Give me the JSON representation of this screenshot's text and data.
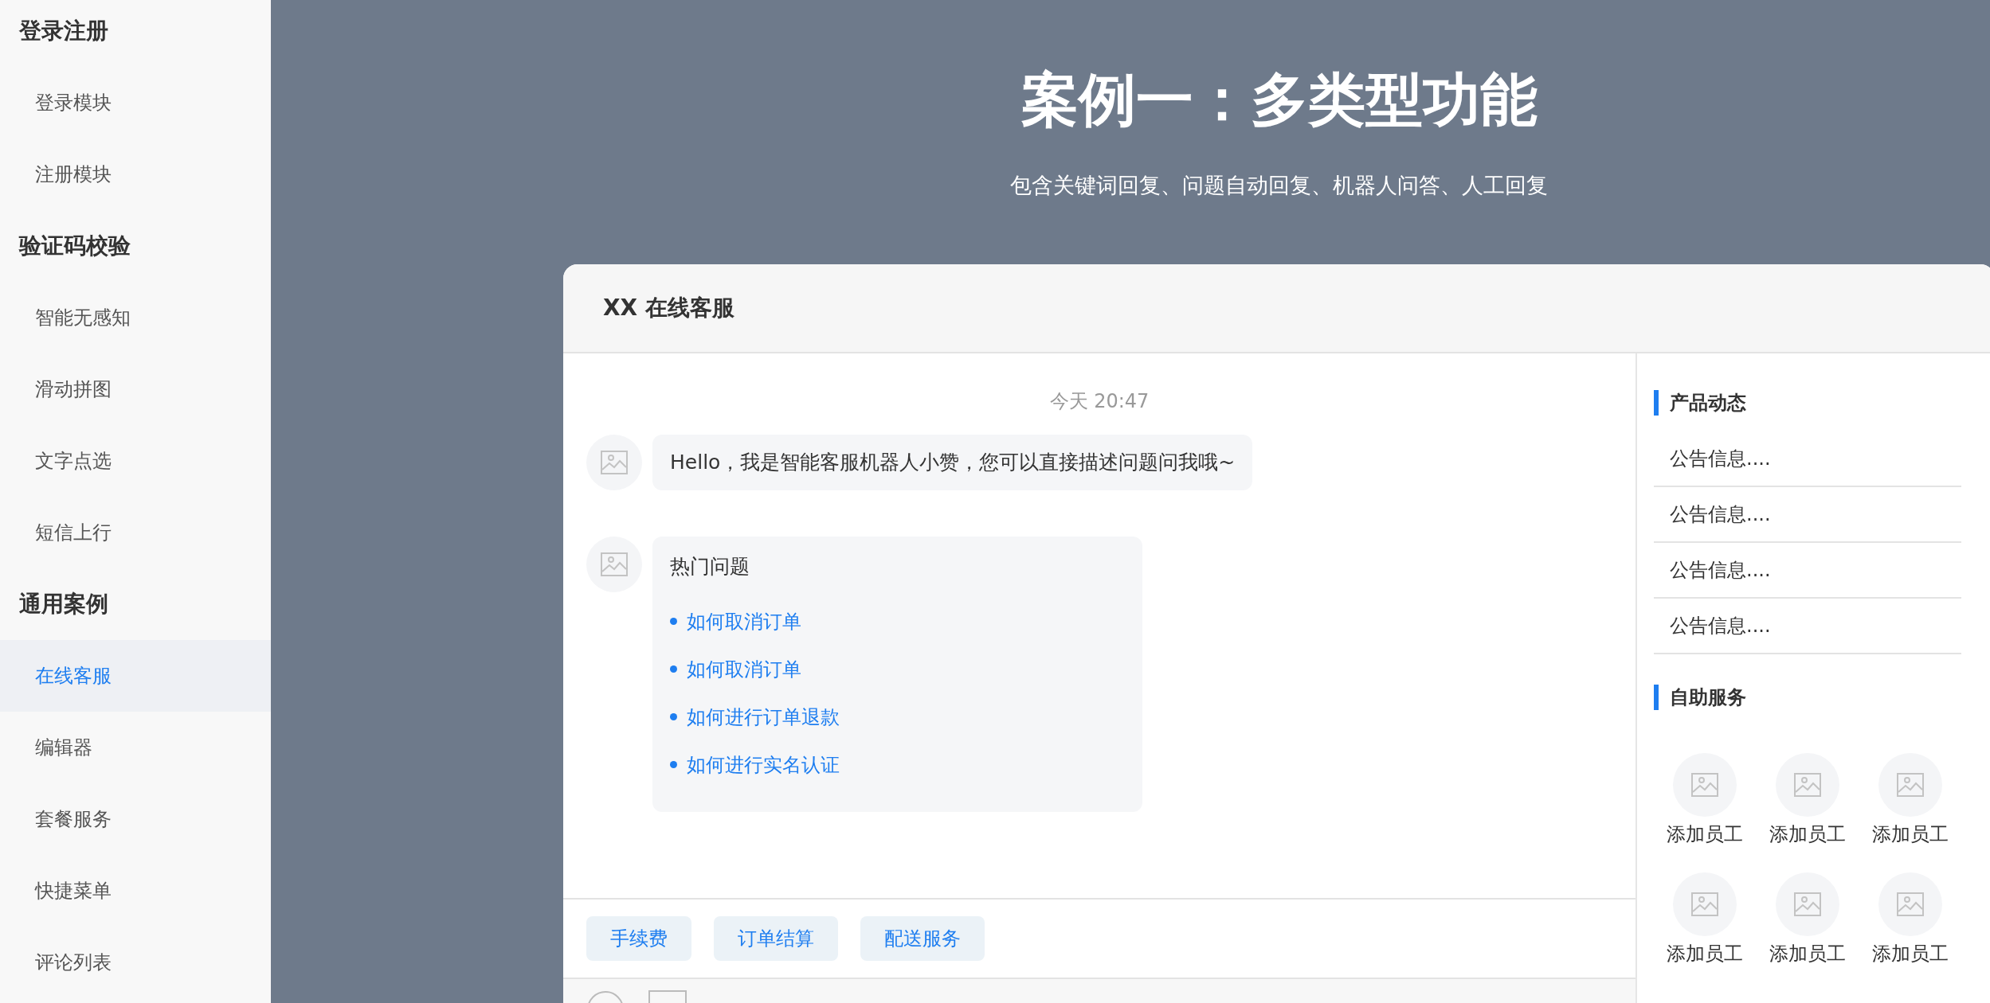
{
  "sidebar": {
    "groups": [
      {
        "title": "登录注册",
        "items": [
          {
            "label": "登录模块",
            "selected": false
          },
          {
            "label": "注册模块",
            "selected": false
          }
        ]
      },
      {
        "title": "验证码校验",
        "items": [
          {
            "label": "智能无感知",
            "selected": false
          },
          {
            "label": "滑动拼图",
            "selected": false
          },
          {
            "label": "文字点选",
            "selected": false
          },
          {
            "label": "短信上行",
            "selected": false
          }
        ]
      },
      {
        "title": "通用案例",
        "items": [
          {
            "label": "在线客服",
            "selected": true
          },
          {
            "label": "编辑器",
            "selected": false
          },
          {
            "label": "套餐服务",
            "selected": false
          },
          {
            "label": "快捷菜单",
            "selected": false
          },
          {
            "label": "评论列表",
            "selected": false
          }
        ]
      }
    ]
  },
  "hero": {
    "title": "案例一：多类型功能",
    "subtitle": "包含关键词回复、问题自动回复、机器人问答、人工回复"
  },
  "chat": {
    "title": "XX 在线客服",
    "timestamp": "今天 20:47",
    "messages": [
      {
        "kind": "text",
        "text": "Hello，我是智能客服机器人小赞，您可以直接描述问题问我哦~"
      },
      {
        "kind": "hot",
        "title": "热门问题",
        "links": [
          "如何取消订单",
          "如何取消订单",
          "如何进行订单退款",
          "如何进行实名认证"
        ]
      }
    ],
    "quick_replies": [
      "手续费",
      "订单结算",
      "配送服务"
    ],
    "news": {
      "title": "产品动态",
      "items": [
        "公告信息....",
        "公告信息....",
        "公告信息....",
        "公告信息...."
      ]
    },
    "services": {
      "title": "自助服务",
      "items": [
        "添加员工",
        "添加员工",
        "添加员工",
        "添加员工",
        "添加员工",
        "添加员工"
      ]
    }
  }
}
